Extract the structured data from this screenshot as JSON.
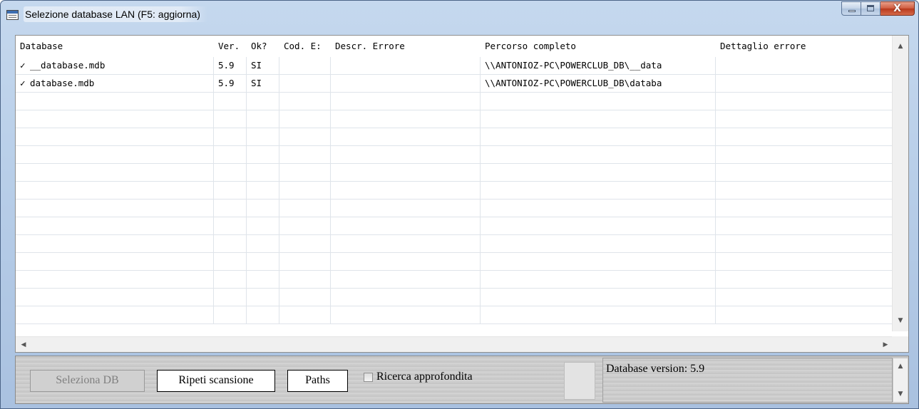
{
  "window": {
    "title": "Selezione database LAN (F5: aggiorna)",
    "close_glyph": "X"
  },
  "grid": {
    "columns": [
      "Database",
      "Ver.",
      "Ok?",
      "Cod. E:",
      "Descr. Errore",
      "Percorso completo",
      "Dettaglio errore"
    ],
    "rows": [
      {
        "check": "✓",
        "database": "__database.mdb",
        "ver": "5.9",
        "ok": "SI",
        "cod": "",
        "descr": "",
        "percorso": "\\\\ANTONIOZ-PC\\POWERCLUB_DB\\__data",
        "dettaglio": ""
      },
      {
        "check": "✓",
        "database": "database.mdb",
        "ver": "5.9",
        "ok": "SI",
        "cod": "",
        "descr": "",
        "percorso": "\\\\ANTONIOZ-PC\\POWERCLUB_DB\\databa",
        "dettaglio": ""
      }
    ],
    "empty_row_count": 13
  },
  "scroll": {
    "up_arrow": "▲",
    "down_arrow": "▼",
    "left_arrow": "◀",
    "right_arrow": "▶"
  },
  "footer": {
    "select_button": "Seleziona DB",
    "rescan_button": "Ripeti scansione",
    "paths_button": "Paths",
    "deep_search_label": "Ricerca approfondita",
    "status_text": "Database version: 5.9"
  }
}
